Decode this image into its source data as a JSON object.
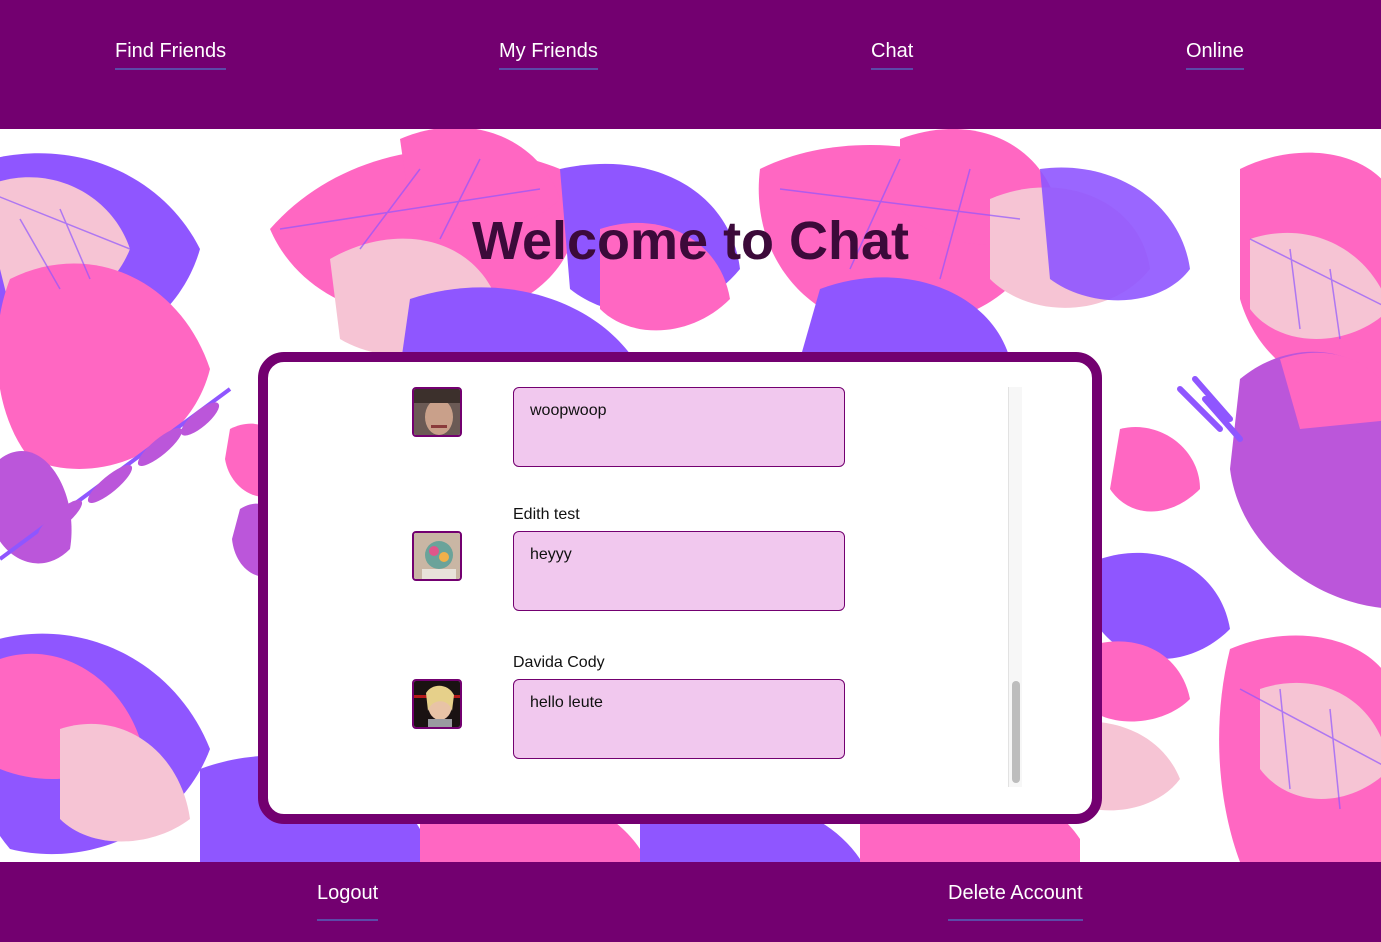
{
  "nav": {
    "find_friends": "Find Friends",
    "my_friends": "My Friends",
    "chat": "Chat",
    "online": "Online"
  },
  "page": {
    "title": "Welcome to Chat"
  },
  "messages": [
    {
      "author": "",
      "text": "woopwoop",
      "avatar": "user-avatar-photo"
    },
    {
      "author": "Edith test",
      "text": "heyyy",
      "avatar": "user-avatar-photo"
    },
    {
      "author": "Davida Cody",
      "text": "hello leute",
      "avatar": "user-avatar-photo"
    }
  ],
  "footer": {
    "logout": "Logout",
    "delete_account": "Delete Account"
  },
  "colors": {
    "brand_purple": "#730070",
    "bubble_pink": "#f1c8ee",
    "title_color": "#3c0a3a",
    "leaf_pink": "#ff5fbf",
    "leaf_violet": "#8a4dff",
    "leaf_blush": "#f6c1d2"
  }
}
